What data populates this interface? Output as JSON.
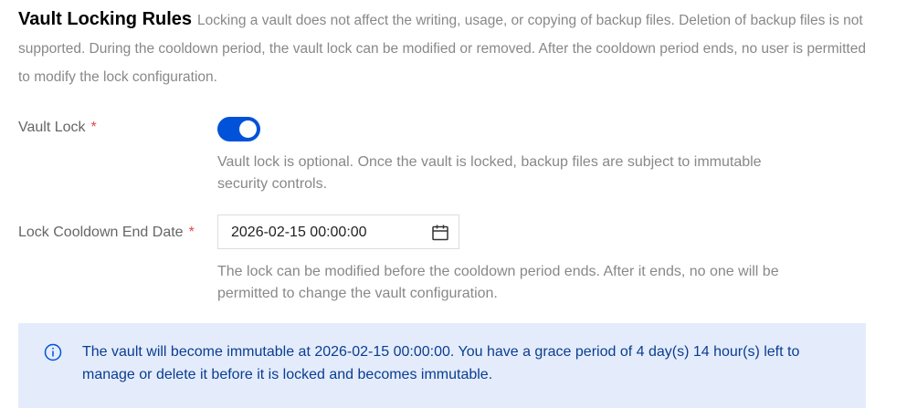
{
  "section": {
    "title": "Vault Locking Rules",
    "description": "Locking a vault does not affect the writing, usage, or copying of backup files. Deletion of backup files is not supported. During the cooldown period, the vault lock can be modified or removed. After the cooldown period ends, no user is permitted to modify the lock configuration."
  },
  "vault_lock": {
    "label": "Vault Lock",
    "required_mark": "*",
    "enabled": true,
    "help": "Vault lock is optional. Once the vault is locked, backup files are subject to immutable security controls."
  },
  "cooldown": {
    "label": "Lock Cooldown End Date",
    "required_mark": "*",
    "value": "2026-02-15 00:00:00",
    "help": "The lock can be modified before the cooldown period ends. After it ends, no one will be permitted to change the vault configuration."
  },
  "notice": {
    "icon": "info-icon",
    "text": "The vault will become immutable at 2026-02-15 00:00:00. You have a grace period of 4 day(s) 14 hour(s) left to manage or delete it before it is locked and becomes immutable."
  },
  "colors": {
    "accent": "#0052d9",
    "required": "#e54545",
    "notice_bg": "#e4ecfb",
    "notice_text": "#0a3d91"
  }
}
